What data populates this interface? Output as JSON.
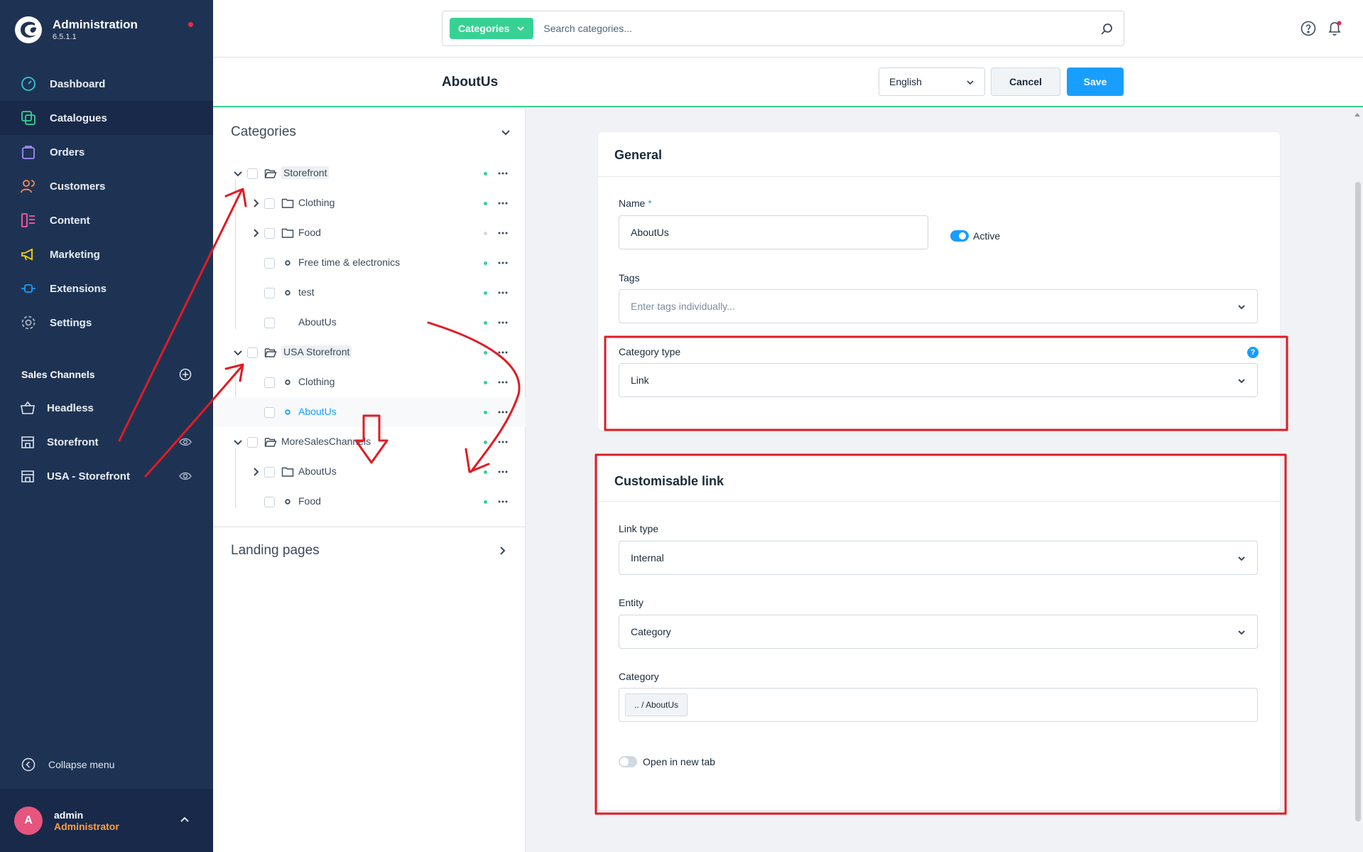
{
  "app": {
    "title": "Administration",
    "version": "6.5.1.1"
  },
  "sidebar": {
    "items": [
      {
        "label": "Dashboard",
        "icon": "gauge-icon"
      },
      {
        "label": "Catalogues",
        "icon": "catalogue-icon"
      },
      {
        "label": "Orders",
        "icon": "shopping-bag-icon"
      },
      {
        "label": "Customers",
        "icon": "users-icon"
      },
      {
        "label": "Content",
        "icon": "content-icon"
      },
      {
        "label": "Marketing",
        "icon": "megaphone-icon"
      },
      {
        "label": "Extensions",
        "icon": "plug-icon"
      },
      {
        "label": "Settings",
        "icon": "gear-icon"
      }
    ],
    "sales_channels_title": "Sales Channels",
    "sales_channels": [
      {
        "label": "Headless",
        "icon": "basket-icon"
      },
      {
        "label": "Storefront",
        "icon": "storefront-icon"
      },
      {
        "label": "USA - Storefront",
        "icon": "storefront-icon"
      }
    ],
    "collapse_label": "Collapse menu",
    "user": {
      "initial": "A",
      "name": "admin",
      "role": "Administrator"
    }
  },
  "search": {
    "type_label": "Categories",
    "placeholder": "Search categories..."
  },
  "smartbar": {
    "title": "AboutUs",
    "language": "English",
    "cancel_label": "Cancel",
    "save_label": "Save"
  },
  "tree": {
    "title": "Categories",
    "nodes": [
      {
        "label": "Storefront",
        "level": 0,
        "expanded": true,
        "type": "folder-open",
        "active": true
      },
      {
        "label": "Clothing",
        "level": 1,
        "collapsed": true,
        "type": "folder",
        "active": true
      },
      {
        "label": "Food",
        "level": 1,
        "collapsed": true,
        "type": "folder",
        "active": false
      },
      {
        "label": "Free time & electronics",
        "level": 1,
        "type": "leaf",
        "active": true
      },
      {
        "label": "test",
        "level": 1,
        "type": "leaf",
        "active": true
      },
      {
        "label": "AboutUs",
        "level": 1,
        "type": "leaf",
        "active": true
      },
      {
        "label": "USA Storefront",
        "level": 0,
        "expanded": true,
        "type": "folder-open",
        "active": true
      },
      {
        "label": "Clothing",
        "level": 1,
        "type": "leaf",
        "active": true
      },
      {
        "label": "AboutUs",
        "level": 1,
        "type": "leaf",
        "active": true,
        "selected": true
      },
      {
        "label": "MoreSalesChannels",
        "level": 0,
        "expanded": true,
        "type": "folder-open",
        "active": true
      },
      {
        "label": "AboutUs",
        "level": 1,
        "collapsed": true,
        "type": "folder",
        "active": true
      },
      {
        "label": "Food",
        "level": 1,
        "type": "leaf",
        "active": true
      }
    ],
    "landing_pages_title": "Landing pages"
  },
  "general": {
    "title": "General",
    "name_label": "Name",
    "name_required": "*",
    "name_value": "AboutUs",
    "active_label": "Active",
    "active": true,
    "tags_label": "Tags",
    "tags_placeholder": "Enter tags individually...",
    "category_type_label": "Category type",
    "category_type_help": "?",
    "category_type_value": "Link"
  },
  "link": {
    "title": "Customisable link",
    "link_type_label": "Link type",
    "link_type_value": "Internal",
    "entity_label": "Entity",
    "entity_value": "Category",
    "category_label": "Category",
    "category_chip": ".. / AboutUs",
    "new_tab_label": "Open in new tab",
    "new_tab": false
  },
  "colors": {
    "sidebar": "#1e3353",
    "accent": "#189eff",
    "success": "#37d293",
    "annotation": "#e01b24"
  }
}
